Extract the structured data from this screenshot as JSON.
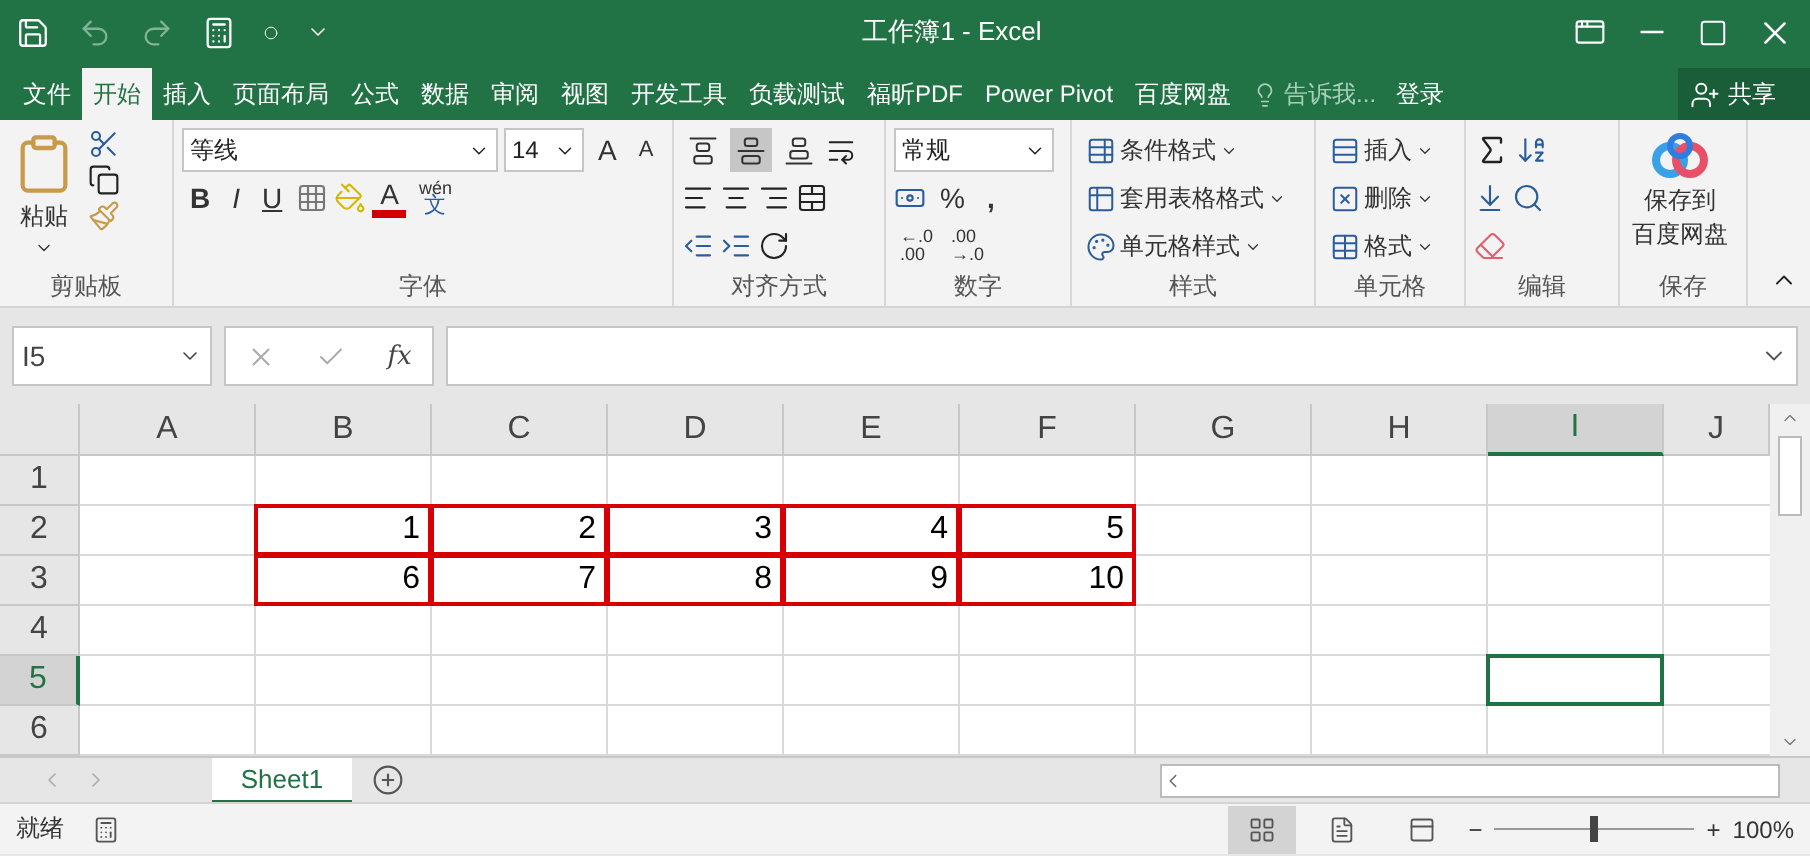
{
  "title_bar": {
    "title": "工作簿1 - Excel"
  },
  "menu_tabs": [
    {
      "label": "文件",
      "selected": false
    },
    {
      "label": "开始",
      "selected": true
    },
    {
      "label": "插入",
      "selected": false
    },
    {
      "label": "页面布局",
      "selected": false
    },
    {
      "label": "公式",
      "selected": false
    },
    {
      "label": "数据",
      "selected": false
    },
    {
      "label": "审阅",
      "selected": false
    },
    {
      "label": "视图",
      "selected": false
    },
    {
      "label": "开发工具",
      "selected": false
    },
    {
      "label": "负载测试",
      "selected": false
    },
    {
      "label": "福昕PDF",
      "selected": false
    },
    {
      "label": "Power Pivot",
      "selected": false
    },
    {
      "label": "百度网盘",
      "selected": false
    }
  ],
  "tell_me": "告诉我...",
  "sign_in": "登录",
  "share": "共享",
  "ribbon": {
    "clipboard": {
      "paste": "粘贴",
      "label": "剪贴板"
    },
    "font": {
      "font_name": "等线",
      "font_size": "14",
      "grow": "A",
      "shrink": "A",
      "bold": "B",
      "italic": "I",
      "underline": "U",
      "font_color": "A",
      "phonetic": [
        "wén",
        "文"
      ],
      "label": "字体"
    },
    "alignment": {
      "vertical": [
        {
          "selected": false
        },
        {
          "selected": true
        },
        {
          "selected": false
        }
      ],
      "label": "对齐方式"
    },
    "number": {
      "format": "常规",
      "percent": "%",
      "comma": ",",
      "increase_decimal": [
        "←.0",
        ".00"
      ],
      "decrease_decimal": [
        ".00",
        "→.0"
      ],
      "label": "数字"
    },
    "styles": {
      "items": [
        "条件格式",
        "套用表格格式",
        "单元格样式"
      ],
      "label": "样式"
    },
    "cells": {
      "items": [
        "插入",
        "删除",
        "格式"
      ],
      "label": "单元格"
    },
    "editing": {
      "label": "编辑"
    },
    "save": {
      "button": [
        "保存到",
        "百度网盘"
      ],
      "label": "保存"
    }
  },
  "formula_bar": {
    "name_box": "I5",
    "fx": "fx"
  },
  "grid": {
    "columns": [
      {
        "label": "A",
        "selected": false
      },
      {
        "label": "B",
        "selected": false
      },
      {
        "label": "C",
        "selected": false
      },
      {
        "label": "D",
        "selected": false
      },
      {
        "label": "E",
        "selected": false
      },
      {
        "label": "F",
        "selected": false
      },
      {
        "label": "G",
        "selected": false
      },
      {
        "label": "H",
        "selected": false
      },
      {
        "label": "I",
        "selected": true
      },
      {
        "label": "J",
        "selected": false
      }
    ],
    "rows": [
      {
        "label": "1",
        "selected": false
      },
      {
        "label": "2",
        "selected": false
      },
      {
        "label": "3",
        "selected": false
      },
      {
        "label": "4",
        "selected": false
      },
      {
        "label": "5",
        "selected": true
      },
      {
        "label": "6",
        "selected": false
      }
    ],
    "bordered_range": [
      [
        "1",
        "2",
        "3",
        "4",
        "5"
      ],
      [
        "6",
        "7",
        "8",
        "9",
        "10"
      ]
    ]
  },
  "sheet_tabs": [
    {
      "label": "Sheet1",
      "selected": true
    }
  ],
  "status_bar": {
    "status": "就绪",
    "zoom_out": "−",
    "zoom_in": "+",
    "zoom": "100%",
    "level": 0.5
  }
}
